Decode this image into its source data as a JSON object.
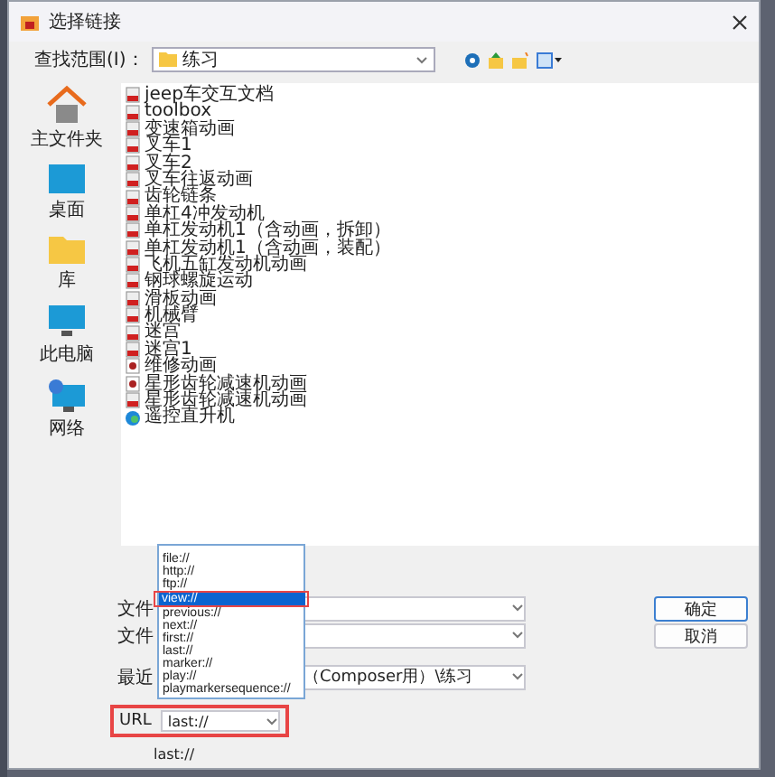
{
  "window": {
    "title": "选择链接"
  },
  "look_in": {
    "label": "查找范围(I)：",
    "value": "练习"
  },
  "sidebar": {
    "items": [
      {
        "label": "主文件夹",
        "kind": "home",
        "selected": false
      },
      {
        "label": "桌面",
        "kind": "desktop",
        "selected": false
      },
      {
        "label": "库",
        "kind": "folder",
        "selected": false
      },
      {
        "label": "此电脑",
        "kind": "computer",
        "selected": false
      },
      {
        "label": "网络",
        "kind": "network",
        "selected": false
      }
    ]
  },
  "files": [
    {
      "name": "jeep车交互文档",
      "kind": "doc"
    },
    {
      "name": "toolbox",
      "kind": "doc"
    },
    {
      "name": "变速箱动画",
      "kind": "doc"
    },
    {
      "name": "叉车1",
      "kind": "doc"
    },
    {
      "name": "叉车2",
      "kind": "doc"
    },
    {
      "name": "叉车往返动画",
      "kind": "doc"
    },
    {
      "name": "齿轮链条",
      "kind": "doc"
    },
    {
      "name": "单杠4冲发动机",
      "kind": "doc"
    },
    {
      "name": "单杠发动机1（含动画，拆卸）",
      "kind": "doc"
    },
    {
      "name": "单杠发动机1（含动画，装配）",
      "kind": "doc"
    },
    {
      "name": "飞机五缸发动机动画",
      "kind": "doc"
    },
    {
      "name": "钢球螺旋运动",
      "kind": "doc"
    },
    {
      "name": "滑板动画",
      "kind": "doc"
    },
    {
      "name": "机械臂",
      "kind": "doc"
    },
    {
      "name": "迷宫",
      "kind": "doc"
    },
    {
      "name": "迷宫1",
      "kind": "doc"
    },
    {
      "name": "维修动画",
      "kind": "media"
    },
    {
      "name": "星形齿轮减速机动画",
      "kind": "media"
    },
    {
      "name": "星形齿轮减速机动画",
      "kind": "doc"
    },
    {
      "name": "遥控直升机",
      "kind": "web"
    }
  ],
  "fields": [
    {
      "label": "文件"
    },
    {
      "label": "文件"
    },
    {
      "label": "最近",
      "value": "（Composer用）\\练习"
    }
  ],
  "buttons": [
    "确定",
    "取消"
  ],
  "url": {
    "label": "URL",
    "value": "last://"
  },
  "url_preview": "last://",
  "url_options": [
    {
      "label": "file://",
      "selected": false
    },
    {
      "label": "http://",
      "selected": false
    },
    {
      "label": "ftp://",
      "selected": false
    },
    {
      "label": "view://",
      "selected": true
    },
    {
      "label": "previous://",
      "selected": false
    },
    {
      "label": "next://",
      "selected": false
    },
    {
      "label": "first://",
      "selected": false
    },
    {
      "label": "last://",
      "selected": false
    },
    {
      "label": "marker://",
      "selected": false
    },
    {
      "label": "play://",
      "selected": false
    },
    {
      "label": "playmarkersequence://",
      "selected": false
    }
  ]
}
